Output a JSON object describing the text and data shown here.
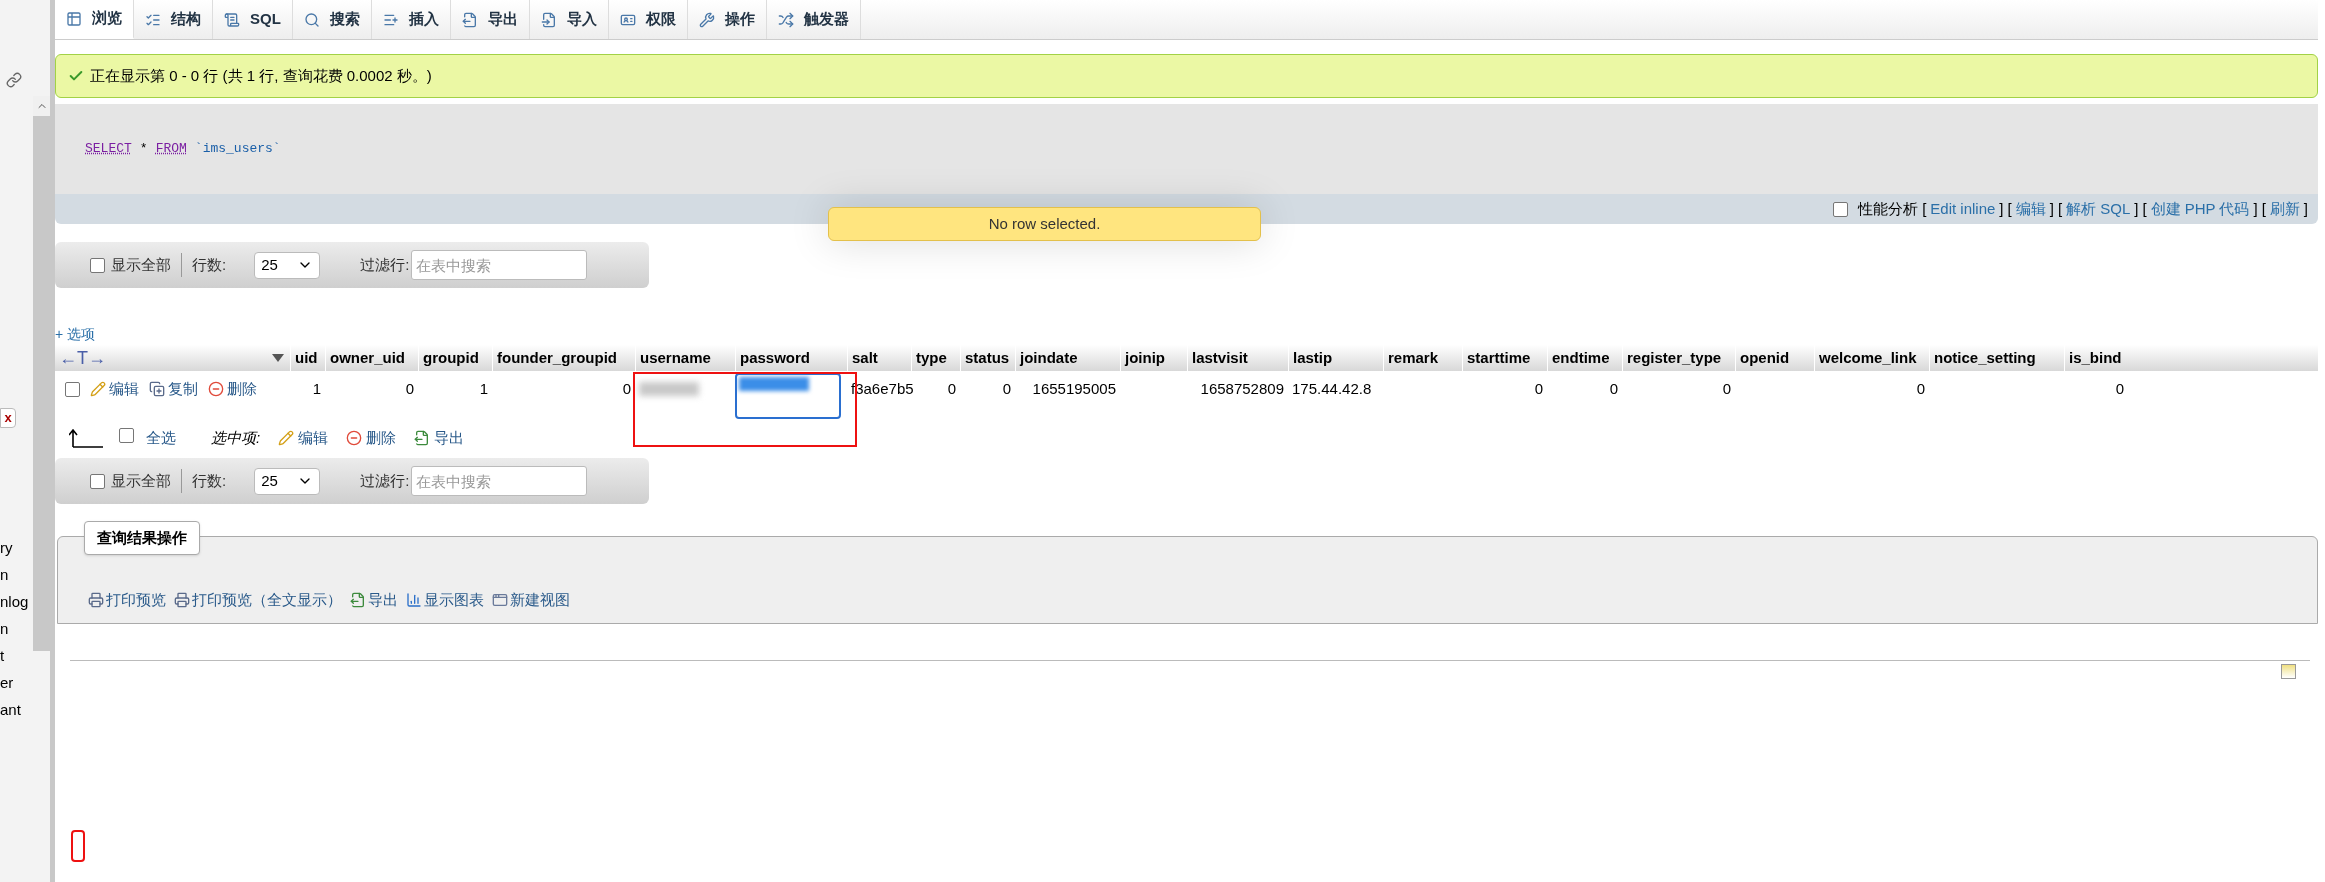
{
  "sidebar": {
    "items": [
      "ry",
      "n",
      "nlog",
      "n",
      "t",
      "er",
      "ant"
    ],
    "close_button": "x"
  },
  "tabs": [
    {
      "label": "浏览",
      "selected": true
    },
    {
      "label": "结构",
      "selected": false
    },
    {
      "label": "SQL",
      "selected": false
    },
    {
      "label": "搜索",
      "selected": false
    },
    {
      "label": "插入",
      "selected": false
    },
    {
      "label": "导出",
      "selected": false
    },
    {
      "label": "导入",
      "selected": false
    },
    {
      "label": "权限",
      "selected": false
    },
    {
      "label": "操作",
      "selected": false
    },
    {
      "label": "触发器",
      "selected": false
    }
  ],
  "message": "正在显示第 0 - 0 行 (共 1 行, 查询花费 0.0002 秒。)",
  "sql": [
    {
      "kind": "keyword",
      "text": "SELECT"
    },
    {
      "kind": "operator",
      "text": "*"
    },
    {
      "kind": "keyword",
      "text": "FROM"
    },
    {
      "kind": "identifier",
      "text": "`ims_users`"
    }
  ],
  "query_options": {
    "profiling": {
      "label": "性能分析",
      "checked": false
    },
    "links": [
      {
        "open": "[",
        "label": "Edit inline",
        "close": "]"
      },
      {
        "open": "[",
        "label": "编辑",
        "close": "]"
      },
      {
        "open": "[",
        "label": "解析 SQL",
        "close": "]"
      },
      {
        "open": "[",
        "label": "创建 PHP 代码",
        "close": "]"
      },
      {
        "open": "[",
        "label": "刷新",
        "close": "]"
      }
    ]
  },
  "tooltip": "No row selected.",
  "navigation": [
    {
      "show_all": {
        "label": "显示全部",
        "checked": false
      },
      "rows_label": "行数:",
      "rows_value": "25",
      "filter_label": "过滤行:",
      "filter_placeholder": "在表中搜索"
    },
    {
      "show_all": {
        "label": "显示全部",
        "checked": false
      },
      "rows_label": "行数:",
      "rows_value": "25",
      "filter_label": "过滤行:",
      "filter_placeholder": "在表中搜索"
    }
  ],
  "options_link": "+ 选项",
  "table": {
    "column_toggle": "←T→",
    "columns": [
      "uid",
      "owner_uid",
      "groupid",
      "founder_groupid",
      "username",
      "password",
      "salt",
      "type",
      "status",
      "joindate",
      "joinip",
      "lastvisit",
      "lastip",
      "remark",
      "starttime",
      "endtime",
      "register_type",
      "openid",
      "welcome_link",
      "notice_setting",
      "is_bind"
    ],
    "rows": [
      {
        "checked": false,
        "actions": [
          {
            "kind": "edit",
            "label": "编辑"
          },
          {
            "kind": "copy",
            "label": "复制"
          },
          {
            "kind": "delete",
            "label": "删除"
          }
        ],
        "cells": [
          {
            "kind": "number",
            "value": "1"
          },
          {
            "kind": "number",
            "value": "0"
          },
          {
            "kind": "number",
            "value": "1"
          },
          {
            "kind": "number",
            "value": "0"
          },
          {
            "kind": "blurred"
          },
          {
            "kind": "editor"
          },
          {
            "kind": "text",
            "value": "f3a6e7b5"
          },
          {
            "kind": "number",
            "value": "0"
          },
          {
            "kind": "number",
            "value": "0"
          },
          {
            "kind": "number",
            "value": "1655195005"
          },
          {
            "kind": "empty"
          },
          {
            "kind": "number",
            "value": "1658752809"
          },
          {
            "kind": "text",
            "value": "175.44.42.8"
          },
          {
            "kind": "empty"
          },
          {
            "kind": "number",
            "value": "0"
          },
          {
            "kind": "number",
            "value": "0"
          },
          {
            "kind": "number",
            "value": "0"
          },
          {
            "kind": "empty"
          },
          {
            "kind": "number",
            "value": "0"
          },
          {
            "kind": "empty"
          },
          {
            "kind": "number",
            "value": "0"
          }
        ]
      }
    ]
  },
  "bulk": {
    "select_all": {
      "label": "全选",
      "checked": false
    },
    "with_selected": "选中项:",
    "actions": [
      {
        "kind": "edit",
        "label": "编辑"
      },
      {
        "kind": "delete",
        "label": "删除"
      },
      {
        "kind": "export",
        "label": "导出"
      }
    ]
  },
  "result_operations": {
    "legend": "查询结果操作",
    "actions": [
      {
        "kind": "print",
        "label": "打印预览"
      },
      {
        "kind": "print",
        "label": "打印预览（全文显示）"
      },
      {
        "kind": "export",
        "label": "导出"
      },
      {
        "kind": "chart",
        "label": "显示图表"
      },
      {
        "kind": "view",
        "label": "新建视图"
      }
    ]
  }
}
